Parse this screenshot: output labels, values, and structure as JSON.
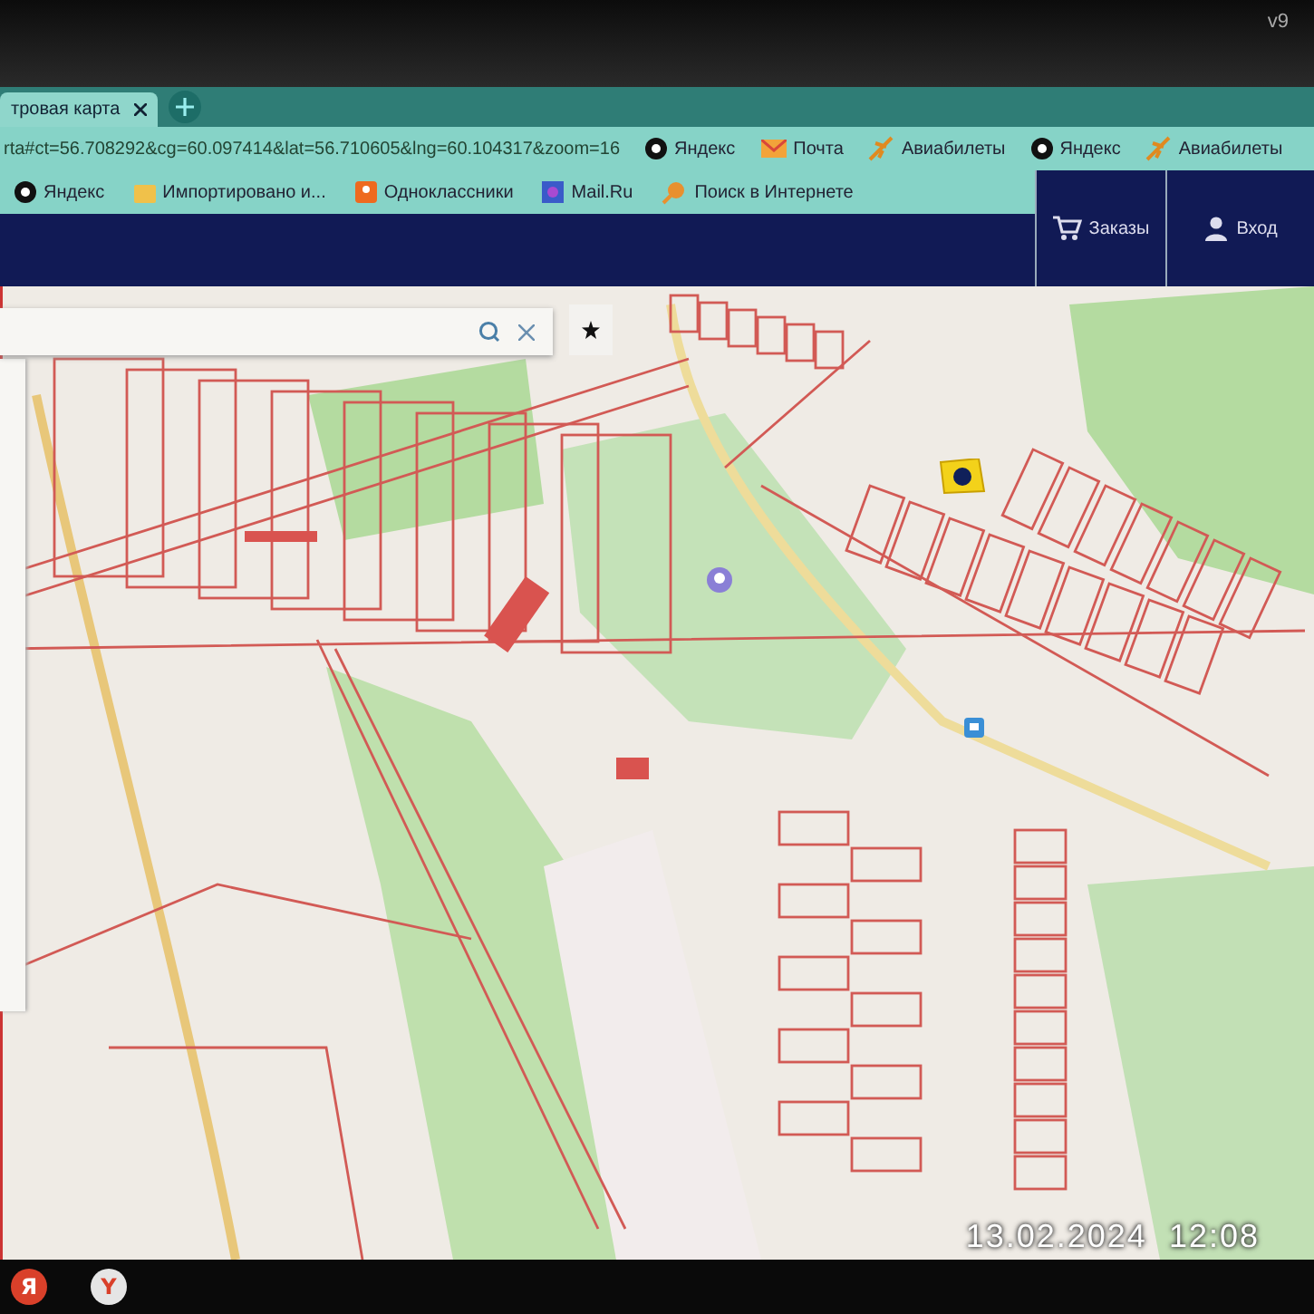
{
  "top_bar": {
    "version": "v9"
  },
  "tabs": [
    {
      "label": "тровая карта",
      "selected": true
    }
  ],
  "address_bar": {
    "url": "rta#ct=56.708292&cg=60.097414&lat=56.710605&lng=60.104317&zoom=16"
  },
  "bookmarks_row_1": [
    {
      "label": "Яндекс",
      "kind": "yandex"
    },
    {
      "label": "Почта",
      "kind": "mail"
    },
    {
      "label": "Авиабилеты",
      "kind": "plane"
    },
    {
      "label": "Яндекс",
      "kind": "yandex"
    },
    {
      "label": "Авиабилеты",
      "kind": "plane"
    }
  ],
  "bookmarks_row_2": [
    {
      "label": "Яндекс",
      "kind": "yandex"
    },
    {
      "label": "Импортировано и...",
      "kind": "folder"
    },
    {
      "label": "Одноклассники",
      "kind": "ok"
    },
    {
      "label": "Mail.Ru",
      "kind": "mailru"
    },
    {
      "label": "Поиск в Интернете",
      "kind": "search"
    }
  ],
  "site_header": {
    "buttons": [
      {
        "label": "Заказы",
        "kind": "cart"
      },
      {
        "label": "Вход",
        "kind": "user"
      }
    ]
  },
  "timestamp": "13.02.2024  12:08",
  "taskbar": {
    "apps": [
      {
        "label": "Я",
        "kind": "yandex"
      },
      {
        "label": "Y",
        "kind": "browser"
      }
    ]
  }
}
